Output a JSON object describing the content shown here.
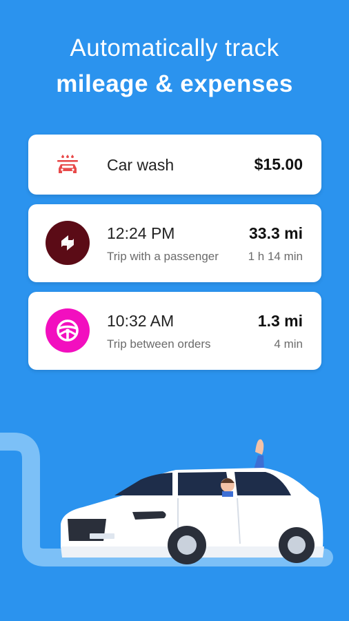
{
  "headline": {
    "line1": "Automatically track",
    "line2": "mileage & expenses"
  },
  "expense": {
    "label": "Car wash",
    "amount": "$15.00",
    "icon": "car-wash-icon",
    "icon_color": "#e84a4a"
  },
  "trips": [
    {
      "time": "12:24 PM",
      "description": "Trip with a passenger",
      "distance": "33.3 mi",
      "duration": "1 h 14 min",
      "icon": "rideshare-logo-icon",
      "icon_bg": "#5b0b16"
    },
    {
      "time": "10:32 AM",
      "description": "Trip between orders",
      "distance": "1.3 mi",
      "duration": "4 min",
      "icon": "steering-wheel-icon",
      "icon_bg": "#f20fbf"
    }
  ],
  "colors": {
    "background": "#2b93ee",
    "road": "#7cc0f7",
    "car": "#ffffff"
  }
}
